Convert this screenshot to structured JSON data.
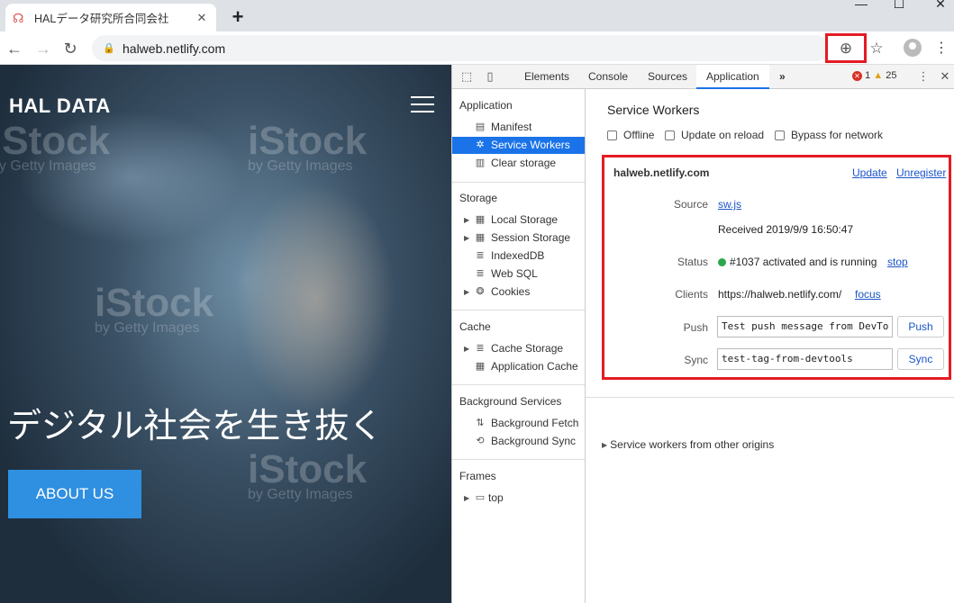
{
  "browser": {
    "tab_title": "HALデータ研究所合同会社",
    "url": "halweb.netlify.com",
    "icons": [
      "hal-favicon-icon",
      "close-icon",
      "new-tab-icon",
      "back-icon",
      "forward-icon",
      "reload-icon",
      "lock-icon",
      "install-app-icon",
      "star-icon",
      "profile-icon",
      "menu-icon"
    ]
  },
  "webpage": {
    "brand": "HAL DATA",
    "hero_text": "デジタル社会を生き抜く",
    "cta_label": "ABOUT US",
    "watermark_brand": "iStock",
    "watermark_sub": "by Getty Images"
  },
  "devtools": {
    "tabs": [
      "Elements",
      "Console",
      "Sources",
      "Application"
    ],
    "active_tab": "Application",
    "more": "»",
    "error_count": "1",
    "warning_count": "25",
    "sidebar": {
      "application_header": "Application",
      "application_items": [
        "Manifest",
        "Service Workers",
        "Clear storage"
      ],
      "storage_header": "Storage",
      "storage_items": [
        "Local Storage",
        "Session Storage",
        "IndexedDB",
        "Web SQL",
        "Cookies"
      ],
      "cache_header": "Cache",
      "cache_items": [
        "Cache Storage",
        "Application Cache"
      ],
      "bg_header": "Background Services",
      "bg_items": [
        "Background Fetch",
        "Background Sync"
      ],
      "frames_header": "Frames",
      "frames_items": [
        "top"
      ]
    },
    "sw": {
      "title": "Service Workers",
      "offline": "Offline",
      "update_on_reload": "Update on reload",
      "bypass": "Bypass for network",
      "origin": "halweb.netlify.com",
      "update": "Update",
      "unregister": "Unregister",
      "source_label": "Source",
      "source_file": "sw.js",
      "received": "Received 2019/9/9 16:50:47",
      "status_label": "Status",
      "status_text": "#1037 activated and is running",
      "stop": "stop",
      "clients_label": "Clients",
      "clients_url": "https://halweb.netlify.com/",
      "focus": "focus",
      "push_label": "Push",
      "push_value": "Test push message from DevTo",
      "push_btn": "Push",
      "sync_label": "Sync",
      "sync_value": "test-tag-from-devtools",
      "sync_btn": "Sync",
      "other_origins": "Service workers from other origins"
    }
  }
}
